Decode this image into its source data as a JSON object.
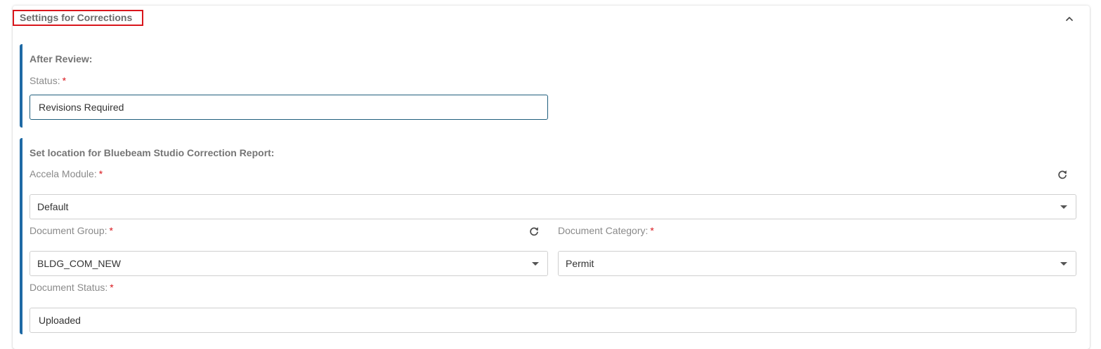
{
  "panel": {
    "title": "Settings for Corrections",
    "collapse_icon": "chevron-up-icon"
  },
  "after_review": {
    "heading": "After Review:",
    "status_label": "Status:",
    "required_mark": "*",
    "status_value": "Revisions Required"
  },
  "report_location": {
    "heading": "Set location for Bluebeam Studio Correction Report:",
    "module_label": "Accela Module:",
    "module_value": "Default",
    "group_label": "Document Group:",
    "group_value": "BLDG_COM_NEW",
    "category_label": "Document Category:",
    "category_value": "Permit",
    "doc_status_label": "Document Status:",
    "doc_status_value": "Uploaded",
    "required_mark": "*",
    "refresh_icon": "refresh-icon",
    "dropdown_icon": "caret-down-icon"
  },
  "colors": {
    "accent": "#1f6aa5",
    "required": "#d9161c",
    "highlight_box": "#d9161c"
  }
}
